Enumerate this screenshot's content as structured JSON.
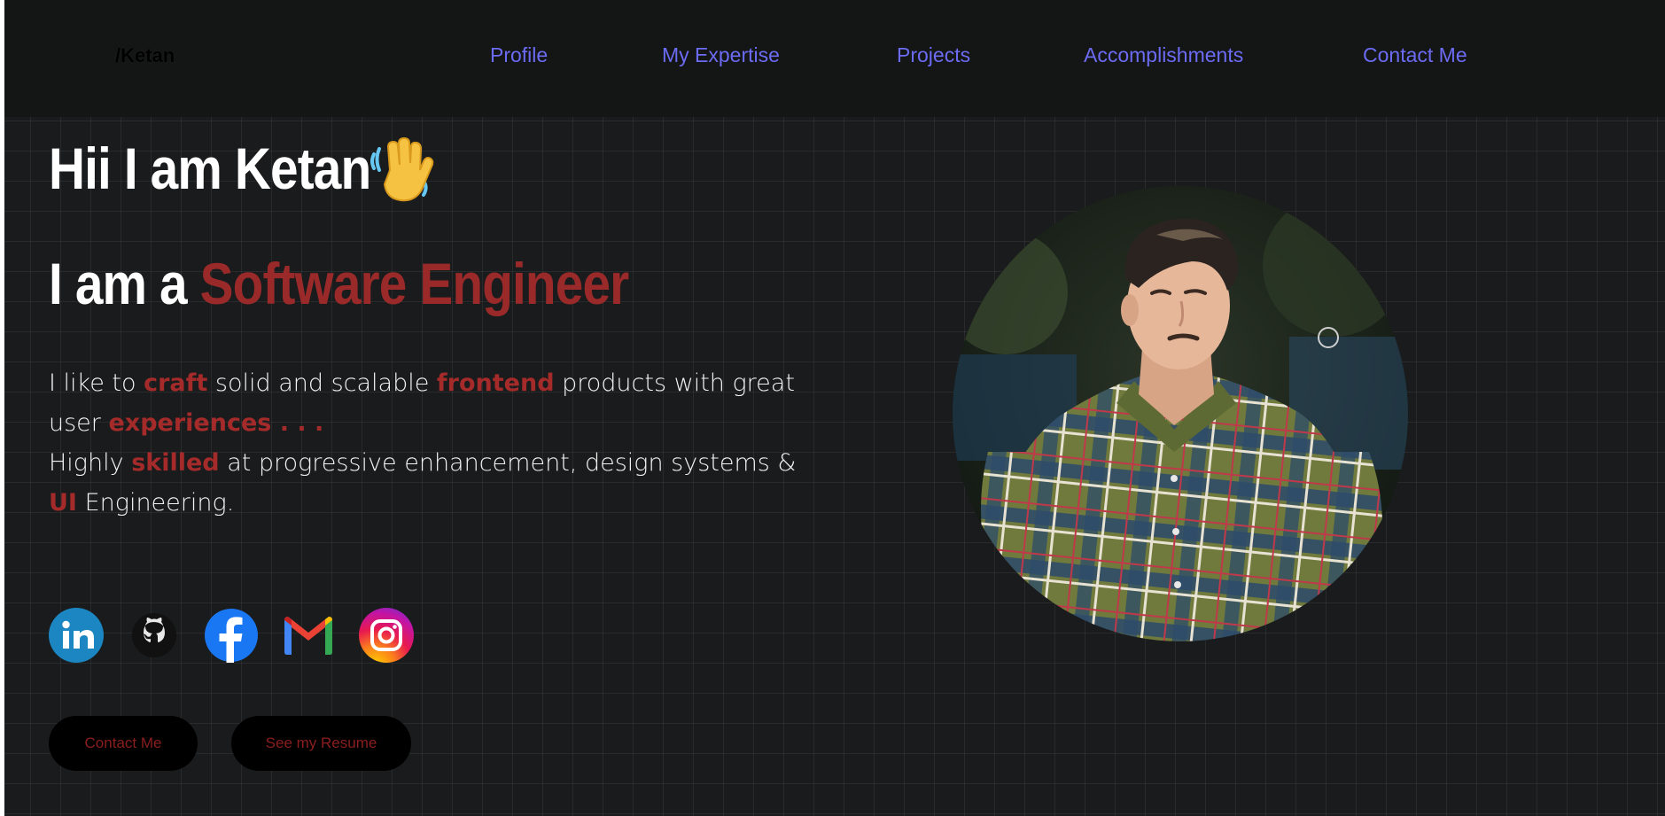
{
  "nav": {
    "logo": "/Ketan",
    "links": [
      "Profile",
      "My Expertise",
      "Projects",
      "Accomplishments",
      "Contact Me"
    ]
  },
  "hero": {
    "greeting": "Hii I am Ketan",
    "wave_icon": "waving-hand-emoji",
    "role_prefix": "I am a ",
    "role": "Software Engineer"
  },
  "about": {
    "p1_a": "I like to ",
    "p1_b": "craft",
    "p1_c": " solid and scalable ",
    "p1_d": "frontend",
    "p1_e": " products with great user ",
    "p1_f": "experiences . . .",
    "p2_a": "Highly ",
    "p2_b": "skilled",
    "p2_c": " at progressive enhancement, design systems & ",
    "p2_d": "UI",
    "p2_e": " Engineering."
  },
  "social": [
    {
      "icon": "linkedin-icon"
    },
    {
      "icon": "github-icon"
    },
    {
      "icon": "facebook-icon"
    },
    {
      "icon": "gmail-icon"
    },
    {
      "icon": "instagram-icon"
    }
  ],
  "buttons": {
    "contact": "Contact Me",
    "resume": "See my Resume"
  },
  "colors": {
    "background": "#1a1b1c",
    "navbar": "#141515",
    "nav_link": "#6c6bf3",
    "accent": "#9a2a2a",
    "button_text": "#8b1e1e"
  }
}
